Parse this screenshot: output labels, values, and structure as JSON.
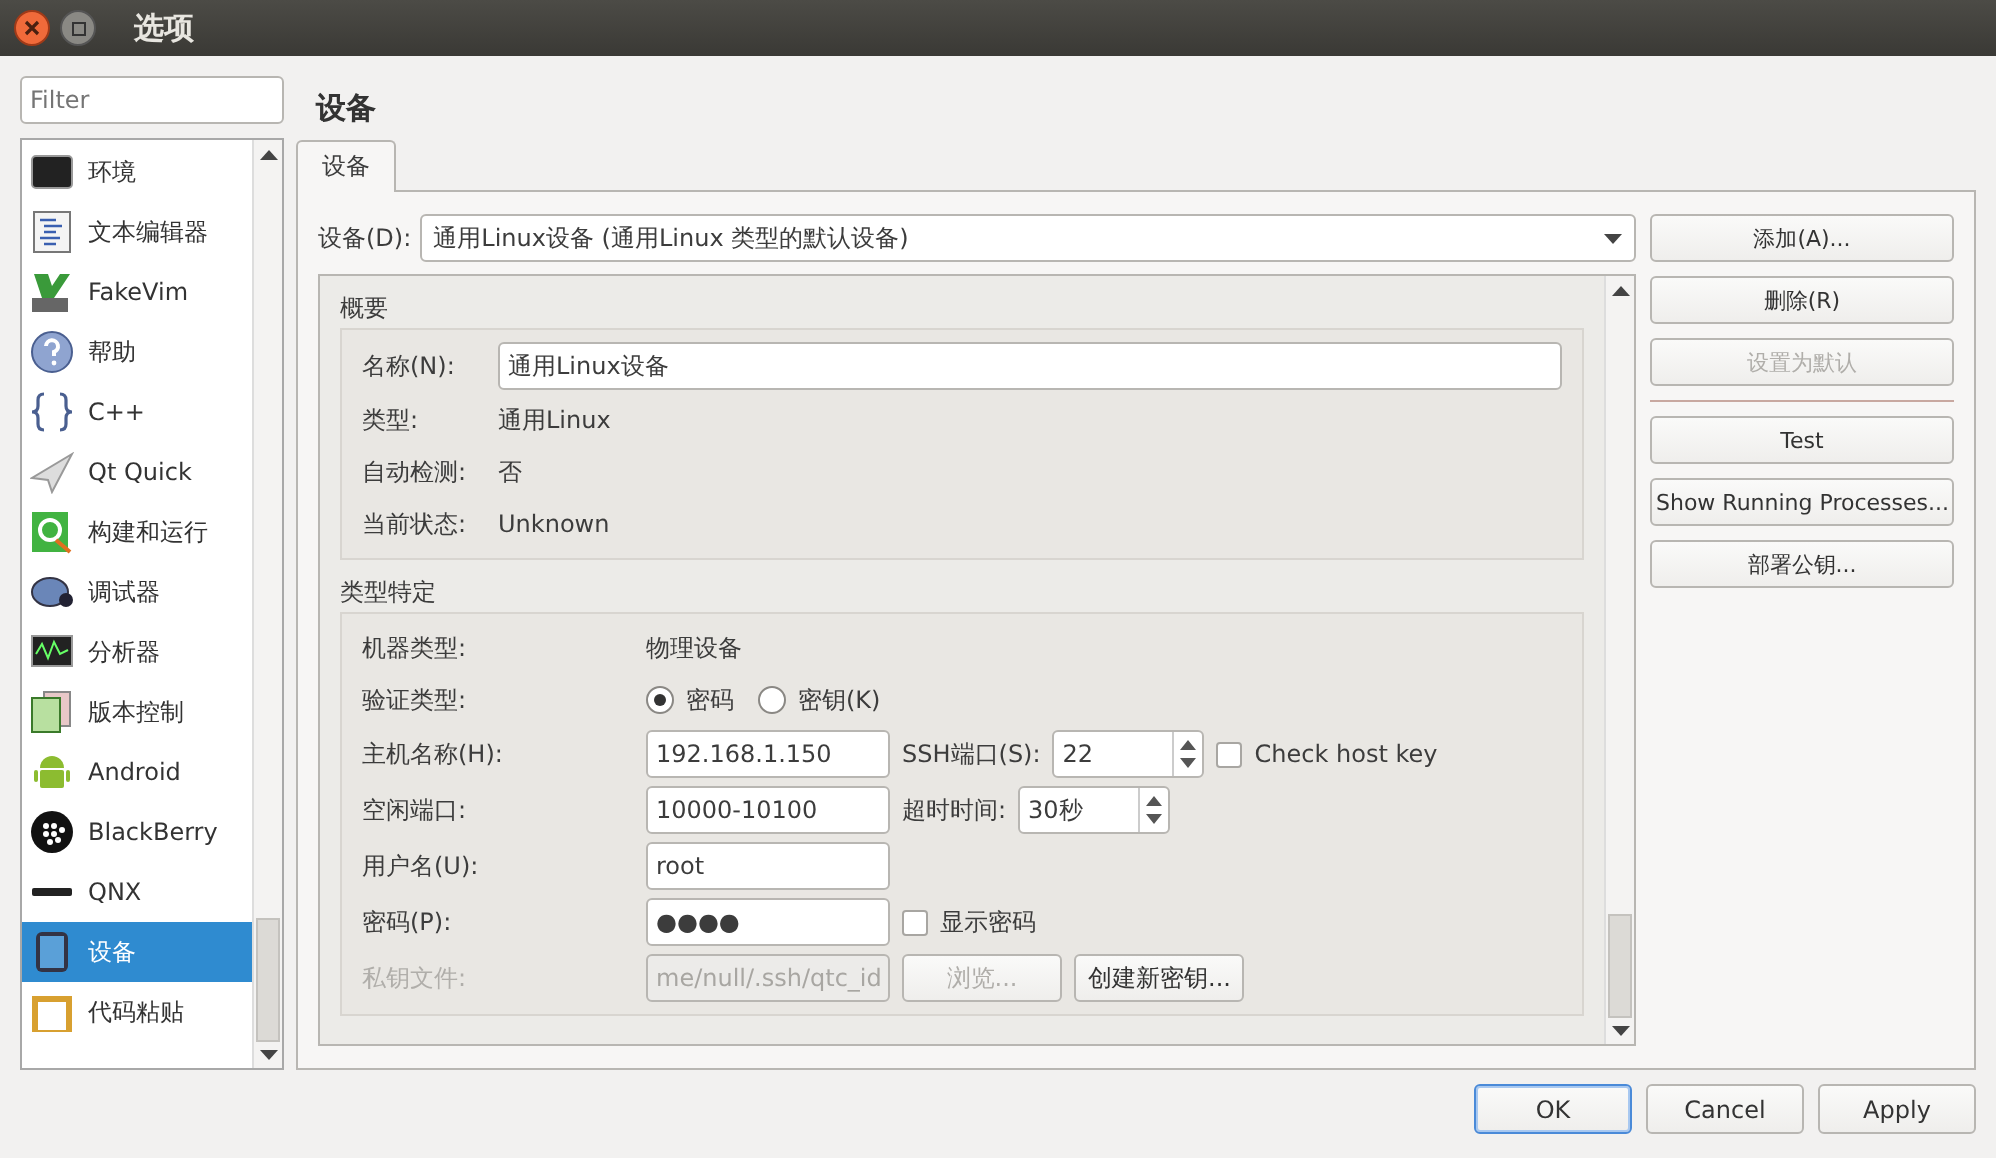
{
  "window": {
    "title": "选项"
  },
  "filter": {
    "placeholder": "Filter"
  },
  "sidebar": {
    "items": [
      {
        "label": "环境",
        "kind": "monitor",
        "selected": false
      },
      {
        "label": "文本编辑器",
        "kind": "document",
        "selected": false
      },
      {
        "label": "FakeVim",
        "kind": "vim",
        "selected": false
      },
      {
        "label": "帮助",
        "kind": "help",
        "selected": false
      },
      {
        "label": "C++",
        "kind": "braces",
        "selected": false
      },
      {
        "label": "Qt Quick",
        "kind": "plane",
        "selected": false
      },
      {
        "label": "构建和运行",
        "kind": "build",
        "selected": false
      },
      {
        "label": "调试器",
        "kind": "bug",
        "selected": false
      },
      {
        "label": "分析器",
        "kind": "scope",
        "selected": false
      },
      {
        "label": "版本控制",
        "kind": "files",
        "selected": false
      },
      {
        "label": "Android",
        "kind": "android",
        "selected": false
      },
      {
        "label": "BlackBerry",
        "kind": "blackberry",
        "selected": false
      },
      {
        "label": "QNX",
        "kind": "qnx",
        "selected": false
      },
      {
        "label": "设备",
        "kind": "tablet",
        "selected": true
      },
      {
        "label": "代码粘贴",
        "kind": "clipboard",
        "selected": false
      }
    ]
  },
  "page_title": "设备",
  "tabs": [
    {
      "label": "设备",
      "selected": true
    }
  ],
  "device": {
    "label": "设备(D):",
    "value": "通用Linux设备 (通用Linux 类型的默认设备)"
  },
  "side_buttons": [
    [
      {
        "label": "添加(A)...",
        "disabled": false
      },
      {
        "label": "删除(R)",
        "disabled": false
      },
      {
        "label": "设置为默认",
        "disabled": true
      }
    ],
    [
      {
        "label": "Test",
        "disabled": false
      },
      {
        "label": "Show Running Processes...",
        "disabled": false
      },
      {
        "label": "部署公钥...",
        "disabled": false
      }
    ]
  ],
  "summary": {
    "title": "概要",
    "name_label": "名称(N):",
    "name_value": "通用Linux设备",
    "rows": [
      {
        "label": "类型:",
        "value": "通用Linux"
      },
      {
        "label": "自动检测:",
        "value": "否"
      },
      {
        "label": "当前状态:",
        "value": "Unknown"
      }
    ]
  },
  "type_specific": {
    "title": "类型特定",
    "machine_type": {
      "label": "机器类型:",
      "value": "物理设备"
    },
    "auth": {
      "label": "验证类型:",
      "options": [
        {
          "label": "密码",
          "selected": true
        },
        {
          "label": "密钥(K)",
          "selected": false
        }
      ]
    },
    "host": {
      "label": "主机名称(H):",
      "value": "192.168.1.150"
    },
    "ssh_port": {
      "label": "SSH端口(S):",
      "value": "22"
    },
    "check_host_key": {
      "label": "Check host key",
      "checked": false
    },
    "free_ports": {
      "label": "空闲端口:",
      "value": "10000-10100"
    },
    "timeout": {
      "label": "超时时间:",
      "value": "30秒"
    },
    "user": {
      "label": "用户名(U):",
      "value": "root"
    },
    "password": {
      "label": "密码(P):",
      "value": "●●●●"
    },
    "show_password": {
      "label": "显示密码",
      "checked": false
    },
    "key_file": {
      "label": "私钥文件:",
      "value": "me/null/.ssh/qtc_id",
      "disabled": true
    },
    "browse": {
      "label": "浏览...",
      "disabled": true
    },
    "create_key": {
      "label": "创建新密钥...",
      "disabled": false
    }
  },
  "dialog_buttons": [
    {
      "label": "OK",
      "default": true
    },
    {
      "label": "Cancel",
      "default": false
    },
    {
      "label": "Apply",
      "default": false
    }
  ]
}
